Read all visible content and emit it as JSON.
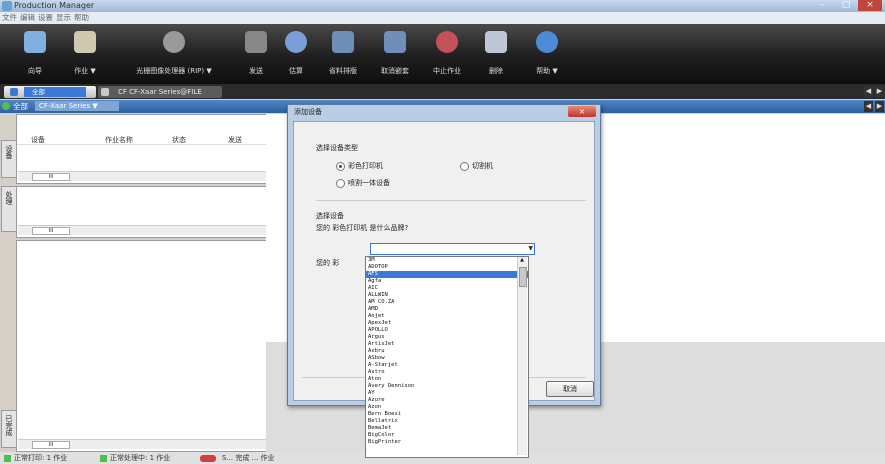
{
  "window": {
    "title": "Production Manager",
    "min_label": "–",
    "max_label": "▢",
    "close_label": "×"
  },
  "menu": [
    "文件",
    "编辑",
    "设置",
    "显示",
    "帮助"
  ],
  "toolbar": [
    {
      "label": "向导",
      "icon": "wizard-icon",
      "color": "#7fb0e0"
    },
    {
      "label": "作业 ▼",
      "icon": "folder-icon",
      "color": "#d0c8b0"
    },
    {
      "label": "光栅图像处理器 (RIP) ▼",
      "icon": "rip-icon",
      "color": "#9a9a9a"
    },
    {
      "label": "发送",
      "icon": "send-icon",
      "color": "#888888"
    },
    {
      "label": "估算",
      "icon": "estimate-icon",
      "color": "#7a9fd8"
    },
    {
      "label": "省料排版",
      "icon": "nesting-icon",
      "color": "#6f8fb8"
    },
    {
      "label": "取消嵌套",
      "icon": "unnest-icon",
      "color": "#6f8fb8"
    },
    {
      "label": "中止作业",
      "icon": "stop-job-icon",
      "color": "#c4505a"
    },
    {
      "label": "删除",
      "icon": "trash-icon",
      "color": "#bfc7d6"
    },
    {
      "label": "帮助 ▼",
      "icon": "help-icon",
      "color": "#4f8ad8"
    }
  ],
  "tabs": {
    "tab1_label": "全部",
    "tab2_label": "CF CF-Xaar Series@FILE"
  },
  "queuebar": {
    "label": "全部",
    "selected": "CF-Xaar Series ▼"
  },
  "left_panel": {
    "columns": [
      "设备",
      "作业名称",
      "状态",
      "发送"
    ],
    "scroll_mid": "III",
    "vtabs": [
      "设备",
      "处理",
      "已完成"
    ]
  },
  "dialog": {
    "title": "添加设备",
    "close": "×",
    "section1": "选择设备类型",
    "radio_color_printer": "彩色打印机",
    "radio_cutter": "切割机",
    "radio_combo": "喷割一体设备",
    "section2": "选择设备",
    "question1": "您的 彩色打印机 是什么品牌?",
    "question2_prefix": "您的 彩",
    "cancel": "取消"
  },
  "brands": [
    "3M",
    "ADOTOP",
    "AFS",
    "Agfa",
    "AIC",
    "ALLWIN",
    "AM CO.ZA",
    "AMD",
    "Anjet",
    "ApexJet",
    "APOLLO",
    "Argus",
    "ArtisJet",
    "Asbru",
    "ASbow",
    "A-Starjet",
    "Astro",
    "Aton",
    "Avery Dennison",
    "AY",
    "Azure",
    "Azon",
    "Bern Boesi",
    "Bellatrix",
    "BemaJet",
    "BigColor",
    "BigPrinter"
  ],
  "selected_brand_index": 2,
  "status": {
    "item1": "正常打印: 1 作业",
    "item2": "正常处理中: 1 作业",
    "item3": "S... 完成 ... 作业"
  }
}
